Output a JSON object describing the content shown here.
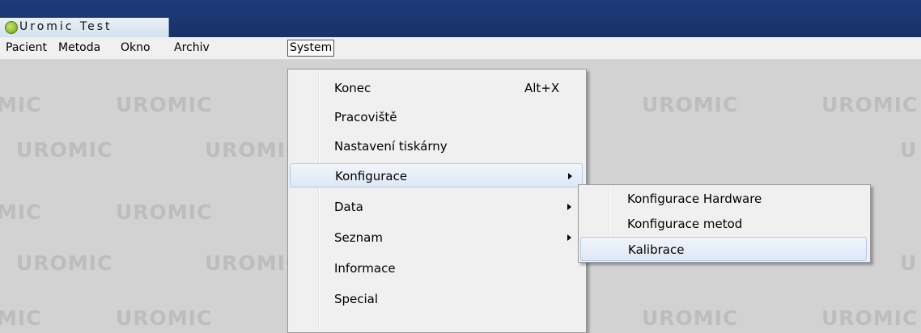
{
  "window": {
    "title": "Uromic Test",
    "icon": "app-logo-icon"
  },
  "menubar": {
    "items": [
      {
        "label": "Pacient"
      },
      {
        "label": "Metoda"
      },
      {
        "label": "Okno"
      },
      {
        "label": "Archiv"
      },
      {
        "label": "System",
        "active": true
      }
    ]
  },
  "watermark": {
    "text": "UROMIC",
    "partial_left": "MIC",
    "partial_right": "U"
  },
  "system_menu": {
    "items": [
      {
        "label": "Konec",
        "shortcut": "Alt+X"
      },
      {
        "label": "Pracoviště"
      },
      {
        "label": "Nastavení tiskárny"
      },
      {
        "label": "Konfigurace",
        "submenu": true,
        "highlighted": true
      },
      {
        "label": "Data",
        "submenu": true
      },
      {
        "label": "Seznam",
        "submenu": true
      },
      {
        "label": "Informace"
      },
      {
        "label": "Special"
      }
    ]
  },
  "konfigurace_submenu": {
    "items": [
      {
        "label": "Konfigurace Hardware"
      },
      {
        "label": "Konfigurace metod"
      },
      {
        "label": "Kalibrace",
        "highlighted": true
      }
    ]
  },
  "colors": {
    "titlebar": "#1e3b7a",
    "menu_bg": "#f0f0f0",
    "highlight": "#dde8f6",
    "desktop": "#d2d2d2",
    "watermark": "#bdbdbd"
  }
}
